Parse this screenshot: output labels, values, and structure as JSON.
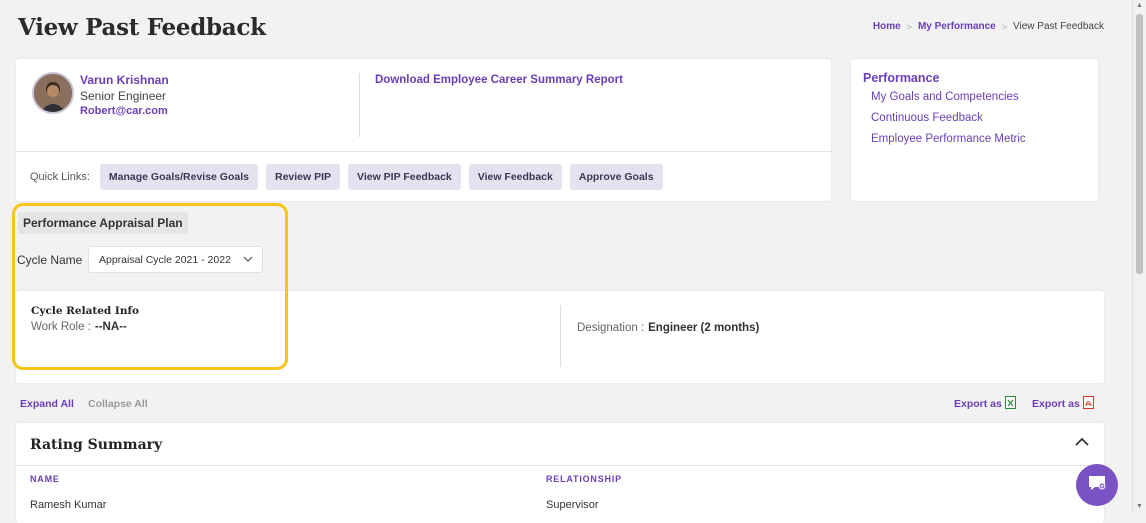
{
  "header": {
    "title": "View Past Feedback"
  },
  "breadcrumb": {
    "home": "Home",
    "my_performance": "My Performance",
    "current": "View Past Feedback"
  },
  "employee": {
    "name": "Varun Krishnan",
    "role": "Senior Engineer",
    "email": "Robert@car.com",
    "download_link": "Download Employee Career Summary Report"
  },
  "quick_links": {
    "label": "Quick Links:",
    "items": [
      "Manage Goals/Revise Goals",
      "Review PIP",
      "View PIP Feedback",
      "View Feedback",
      "Approve Goals"
    ]
  },
  "performance_menu": {
    "title": "Performance",
    "items": [
      "My Goals and Competencies",
      "Continuous Feedback",
      "Employee Performance Metric"
    ]
  },
  "appraisal": {
    "section_label": "Performance Appraisal Plan",
    "cycle_label": "Cycle Name",
    "cycle_value": "Appraisal Cycle 2021 - 2022"
  },
  "cycle_info": {
    "title": "Cycle Related Info",
    "work_role_label": "Work Role :",
    "work_role_value": "--NA--",
    "designation_label": "Designation :",
    "designation_value": "Engineer (2 months)"
  },
  "controls": {
    "expand_all": "Expand All",
    "collapse_all": "Collapse All",
    "export_excel": "Export as",
    "export_pdf": "Export as"
  },
  "rating_summary": {
    "title": "Rating Summary",
    "columns": [
      "NAME",
      "RELATIONSHIP"
    ],
    "rows": [
      [
        "Ramesh Kumar",
        "Supervisor"
      ]
    ]
  },
  "colors": {
    "accent": "#6a3fb4",
    "highlight": "#f5c518",
    "chat": "#7b52c4"
  },
  "icons": {
    "chat": "chat-icon",
    "excel": "excel-icon",
    "pdf": "pdf-icon",
    "chevron": "chevron-down-icon",
    "collapse": "chevron-up-icon"
  }
}
